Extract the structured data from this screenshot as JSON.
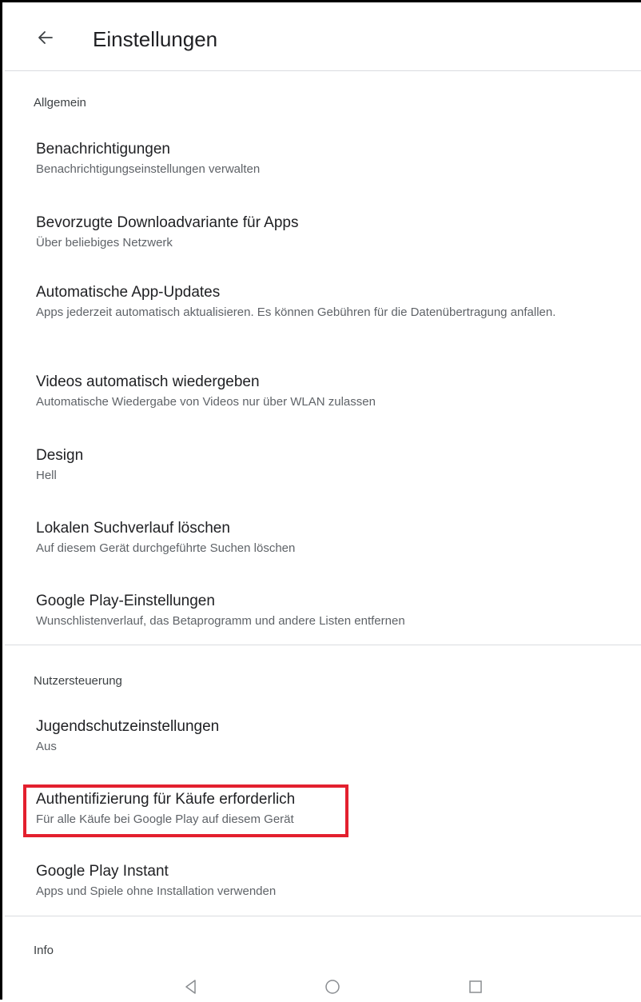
{
  "header": {
    "title": "Einstellungen"
  },
  "sections": {
    "general": {
      "header": "Allgemein",
      "items": [
        {
          "title": "Benachrichtigungen",
          "subtitle": "Benachrichtigungseinstellungen verwalten"
        },
        {
          "title": "Bevorzugte Downloadvariante für Apps",
          "subtitle": "Über beliebiges Netzwerk"
        },
        {
          "title": "Automatische App-Updates",
          "subtitle": "Apps jederzeit automatisch aktualisieren. Es können Gebühren für die Datenübertragung anfallen."
        },
        {
          "title": "Videos automatisch wiedergeben",
          "subtitle": "Automatische Wiedergabe von Videos nur über WLAN zulassen"
        },
        {
          "title": "Design",
          "subtitle": "Hell"
        },
        {
          "title": "Lokalen Suchverlauf löschen",
          "subtitle": "Auf diesem Gerät durchgeführte Suchen löschen"
        },
        {
          "title": "Google Play-Einstellungen",
          "subtitle": "Wunschlistenverlauf, das Betaprogramm und andere Listen entfernen"
        }
      ]
    },
    "user_controls": {
      "header": "Nutzersteuerung",
      "items": [
        {
          "title": "Jugendschutzeinstellungen",
          "subtitle": "Aus"
        },
        {
          "title": "Authentifizierung für Käufe erforderlich",
          "subtitle": "Für alle Käufe bei Google Play auf diesem Gerät"
        },
        {
          "title": "Google Play Instant",
          "subtitle": "Apps und Spiele ohne Installation verwenden"
        }
      ]
    },
    "info": {
      "header": "Info"
    }
  },
  "icons": {
    "back": "arrow-back-icon",
    "nav_back": "triangle-back-icon",
    "nav_home": "circle-home-icon",
    "nav_recents": "square-recents-icon"
  },
  "colors": {
    "highlight": "#e3202e",
    "text_primary": "#202124",
    "text_secondary": "#5f6368",
    "divider": "#dadce0"
  }
}
